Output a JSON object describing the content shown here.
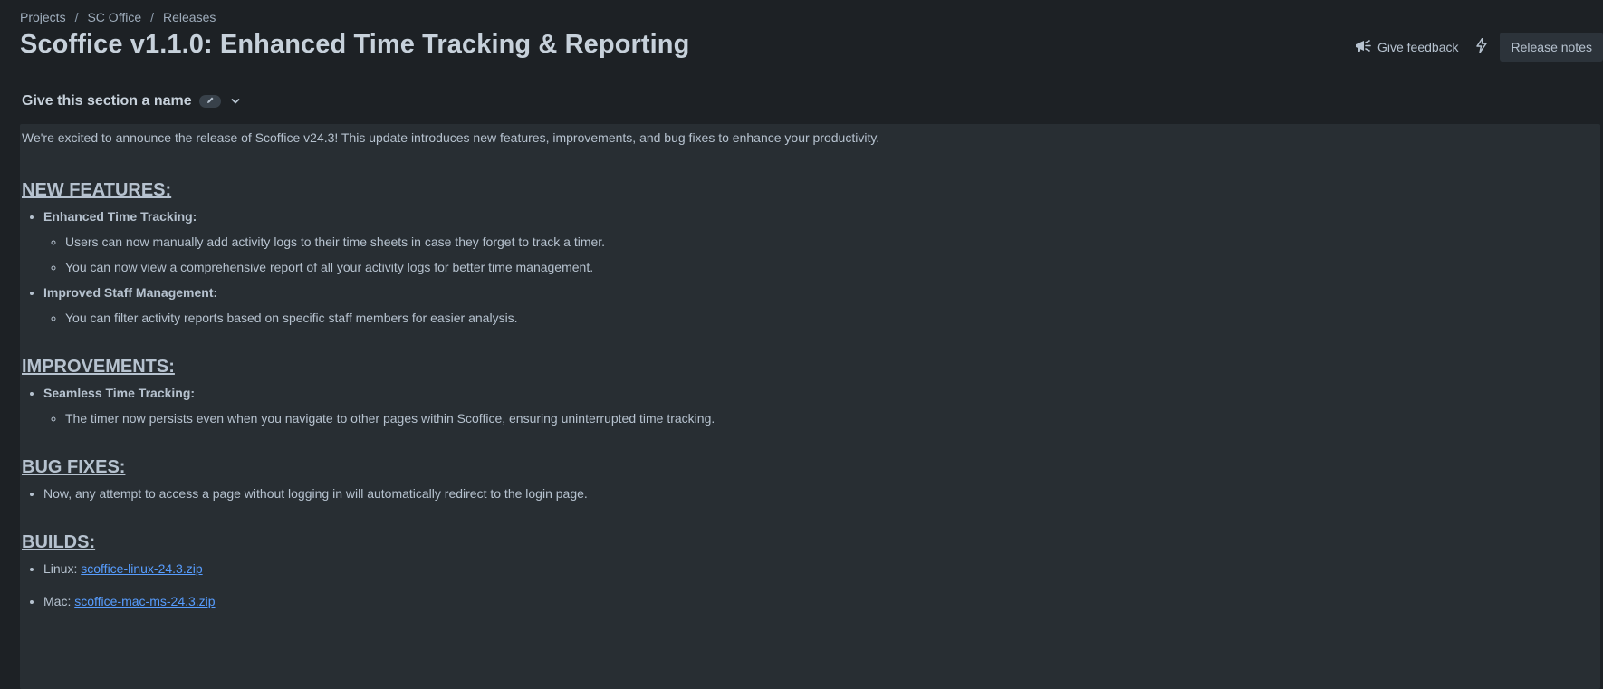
{
  "breadcrumb": {
    "items": [
      "Projects",
      "SC Office",
      "Releases"
    ],
    "separator": "/"
  },
  "page": {
    "title": "Scoffice v1.1.0: Enhanced Time Tracking & Reporting"
  },
  "header_actions": {
    "feedback_label": "Give feedback",
    "feedback_icon": "megaphone-icon",
    "bolt_icon": "lightning-bolt-icon",
    "release_notes_label": "Release notes"
  },
  "section": {
    "name": "Give this section a name",
    "edit_icon": "pencil-icon",
    "toggle_icon": "chevron-down-icon"
  },
  "content": {
    "intro": "We're excited to announce the release of Scoffice v24.3! This update introduces new features, improvements, and bug fixes to enhance your productivity.",
    "new_features": {
      "heading": "NEW FEATURES:",
      "items": [
        {
          "title": "Enhanced Time Tracking:",
          "subitems": [
            "Users can now manually add activity logs to their time sheets in case they forget to track a timer.",
            "You can now view a comprehensive report of all your activity logs for better time management."
          ]
        },
        {
          "title": "Improved Staff Management:",
          "subitems": [
            "You can filter activity reports based on specific staff members for easier analysis."
          ]
        }
      ]
    },
    "improvements": {
      "heading": "IMPROVEMENTS:",
      "items": [
        {
          "title": "Seamless Time Tracking:",
          "subitems": [
            "The timer now persists even when you navigate to other pages within Scoffice, ensuring uninterrupted time tracking."
          ]
        }
      ]
    },
    "bug_fixes": {
      "heading": "BUG FIXES:",
      "items": [
        "Now, any attempt to access a page without logging in will automatically redirect to the login page."
      ]
    },
    "builds": {
      "heading": "BUILDS:",
      "items": [
        {
          "label": "Linux:",
          "file": "scoffice-linux-24.3.zip"
        },
        {
          "label": "Mac:",
          "file": "scoffice-mac-ms-24.3.zip"
        }
      ]
    }
  },
  "colors": {
    "background": "#1d2125",
    "panel": "#282e33",
    "text": "#b6c2cf",
    "link": "#579dff",
    "button_bg": "#2c333a"
  }
}
